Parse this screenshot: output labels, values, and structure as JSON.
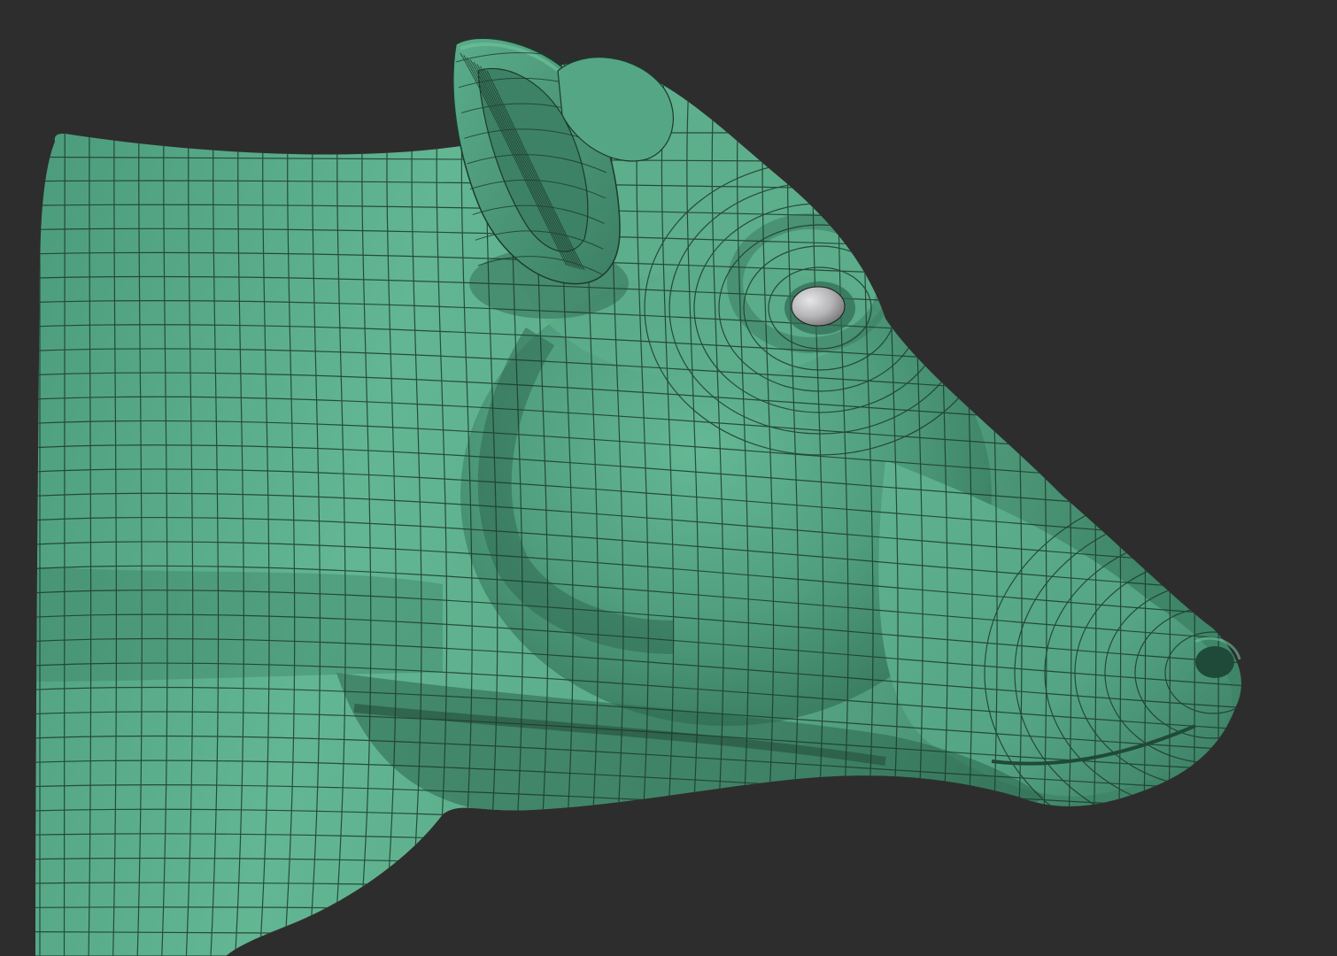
{
  "scene": {
    "subject": "cow-head-mesh",
    "colors": {
      "background": "#2d2d2e",
      "mesh_base": "#4e9e7f",
      "mesh_light": "#68bd97",
      "mesh_shadow": "#2f6a52",
      "mesh_deep_shadow": "#1f4a39",
      "wire": "#1c3a2c",
      "eye": "#b8b8ba",
      "eye_highlight": "#e4e4e6"
    },
    "icons": {
      "eye": "sphere-eye",
      "ear": "ear-cup",
      "nose": "nostril"
    }
  }
}
